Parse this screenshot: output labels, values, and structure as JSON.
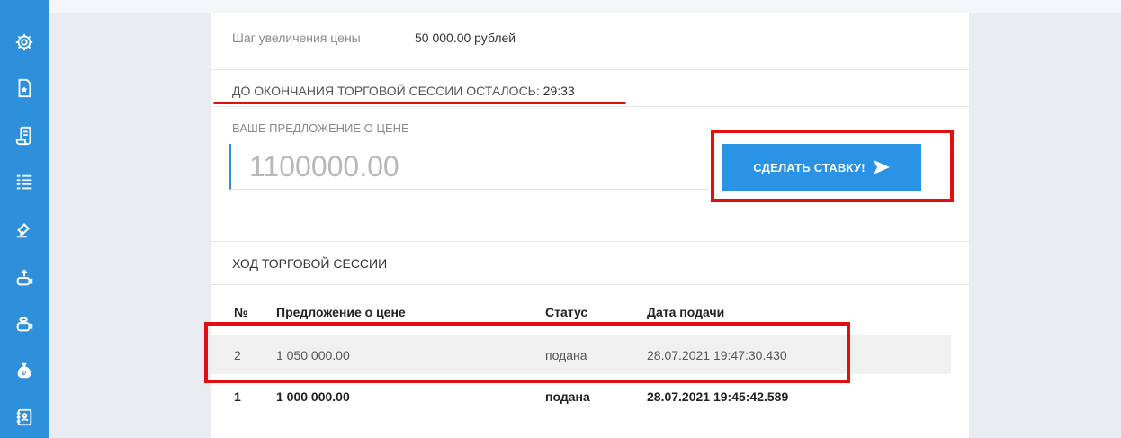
{
  "sidebar": {
    "bg_color": "#2e8fda",
    "icons": [
      "settings-gear-icon",
      "document-star-icon",
      "scroll-icon",
      "list-icon",
      "gavel-icon",
      "rise-to-top-icon",
      "bowl-icon",
      "ruble-moneybag-icon",
      "address-book-icon"
    ]
  },
  "auction": {
    "step_label": "Шаг увеличения цены",
    "step_value": "50 000.00 рублей",
    "timer_label": "ДО ОКОНЧАНИЯ ТОРГОВОЙ СЕССИИ ОСТАЛОСЬ: ",
    "timer_value": "29:33"
  },
  "offer": {
    "label": "ВАШЕ ПРЕДЛОЖЕНИЕ О ЦЕНЕ",
    "placeholder": "1100000.00",
    "button_label": "СДЕЛАТЬ СТАВКУ!",
    "button_color": "#2b93e6"
  },
  "session": {
    "title": "ХОД ТОРГОВОЙ СЕССИИ",
    "headers": [
      "№",
      "Предложение о цене",
      "Статус",
      "Дата подачи"
    ],
    "rows": [
      [
        "2",
        "1 050 000.00",
        "подана",
        "28.07.2021 19:47:30.430"
      ],
      [
        "1",
        "1 000 000.00",
        "подана",
        "28.07.2021 19:45:42.589"
      ]
    ]
  },
  "annotation_color": "#e01010"
}
